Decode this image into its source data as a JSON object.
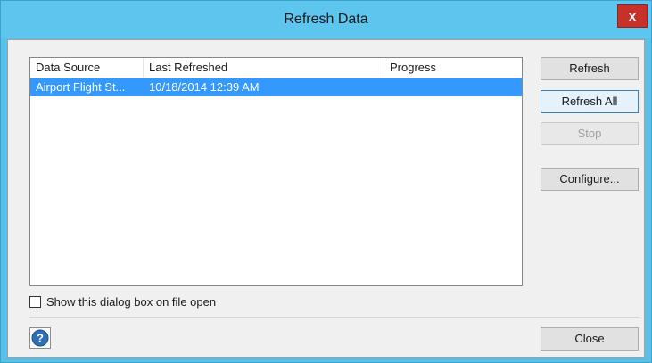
{
  "window": {
    "title": "Refresh Data",
    "close_glyph": "x"
  },
  "list": {
    "columns": [
      "Data Source",
      "Last Refreshed",
      "Progress"
    ],
    "rows": [
      {
        "data_source": "Airport Flight St...",
        "last_refreshed": "10/18/2014 12:39 AM",
        "progress": ""
      }
    ]
  },
  "buttons": {
    "refresh": "Refresh",
    "refresh_all": "Refresh All",
    "stop": "Stop",
    "configure": "Configure...",
    "close": "Close"
  },
  "options": {
    "show_on_open_label": "Show this dialog box on file open",
    "show_on_open_checked": false
  },
  "help": {
    "icon": "help-icon"
  },
  "colors": {
    "titlebar": "#5ec5ee",
    "selection": "#3399ff",
    "close_button": "#c7312a"
  }
}
